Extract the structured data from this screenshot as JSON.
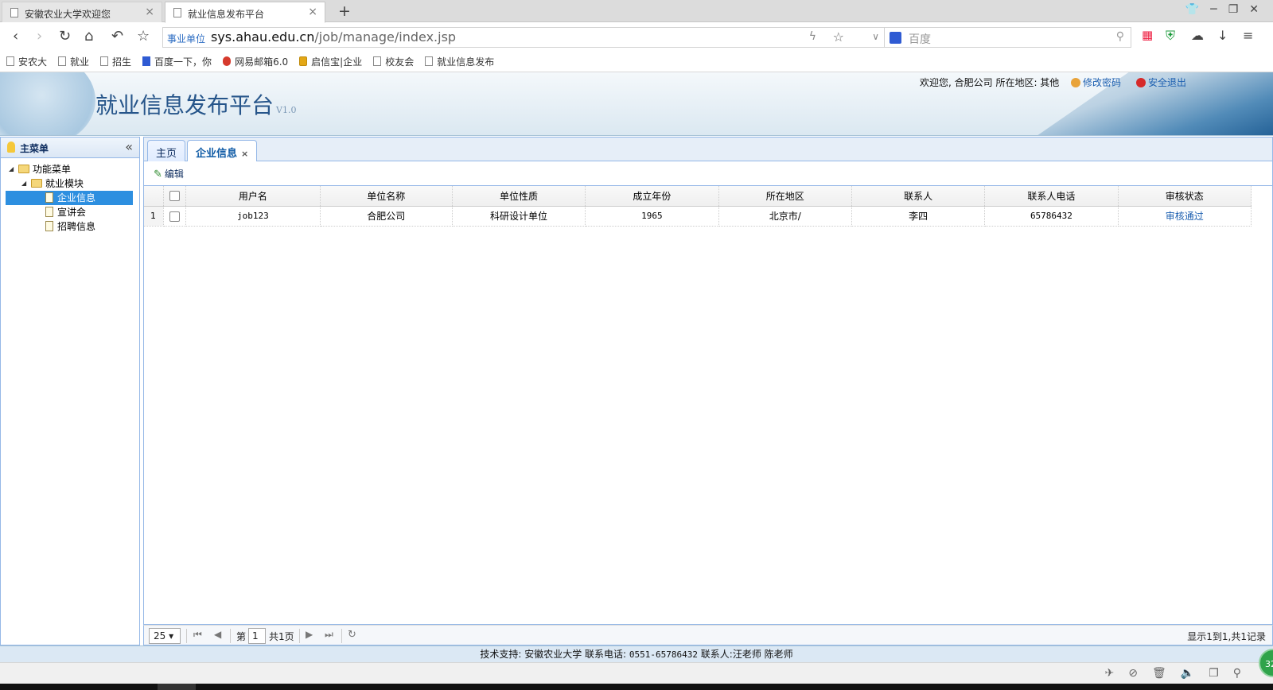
{
  "browser": {
    "tabs": [
      {
        "title": "安徽农业大学欢迎您",
        "active": false
      },
      {
        "title": "就业信息发布平台",
        "active": true
      }
    ],
    "new_tab": "+",
    "url_badge": "事业单位",
    "url_host": "sys.ahau.edu.cn",
    "url_path": "/job/manage/index.jsp",
    "search_placeholder": "百度",
    "bookmarks": [
      "安农大",
      "就业",
      "招生",
      "百度一下，你",
      "网易邮箱6.0",
      "启信宝|企业",
      "校友会",
      "就业信息发布"
    ]
  },
  "header": {
    "title": "就业信息发布平台",
    "version": "V1.0",
    "welcome": "欢迎您, 合肥公司  所在地区: 其他",
    "change_password": "修改密码",
    "logout": "安全退出"
  },
  "sidebar": {
    "title": "主菜单",
    "collapse_icon": "«",
    "tree": {
      "root": "功能菜单",
      "module": "就业模块",
      "items": [
        "企业信息",
        "宣讲会",
        "招聘信息"
      ],
      "selected": "企业信息"
    }
  },
  "panel_tabs": {
    "home": "主页",
    "current": "企业信息",
    "close": "×"
  },
  "toolbar": {
    "edit_label": "编辑"
  },
  "grid": {
    "columns": [
      "用户名",
      "单位名称",
      "单位性质",
      "成立年份",
      "所在地区",
      "联系人",
      "联系人电话",
      "审核状态"
    ],
    "rows": [
      {
        "rownum": "1",
        "username": "job123",
        "company": "合肥公司",
        "nature": "科研设计单位",
        "year": "1965",
        "region": "北京市/",
        "contact": "李四",
        "phone": "65786432",
        "status": "审核通过"
      }
    ]
  },
  "pager": {
    "page_size": "25",
    "page_prefix": "第",
    "page_value": "1",
    "page_total": "共1页",
    "info": "显示1到1,共1记录"
  },
  "footer": {
    "support": "技术支持: 安徽农业大学  联系电话: ",
    "phone": "0551-65786432",
    "contacts": "  联系人:汪老师 陈老师"
  },
  "status_badge": "32",
  "colors": {
    "accent": "#2d8fe0",
    "border": "#95b8e7",
    "title": "#26558a",
    "link": "#1c5fb0"
  }
}
